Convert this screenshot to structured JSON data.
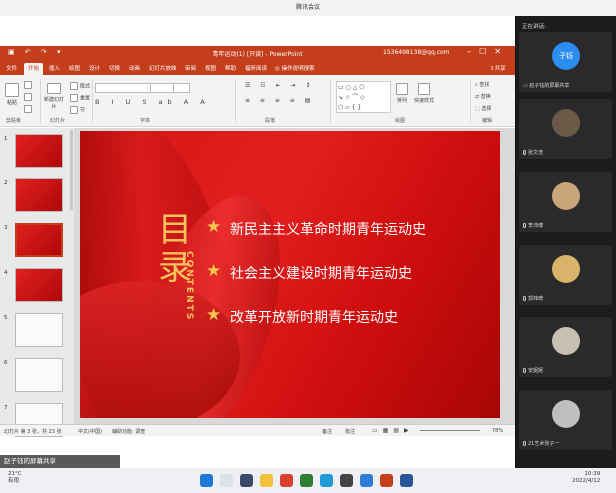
{
  "meeting": {
    "title": "腾讯会议",
    "shared_label": "赵子钰的屏幕共享"
  },
  "powerpoint": {
    "window_title": "青年运动(1) [只读] - PowerPoint",
    "account": "1536498138@qq.com",
    "tabs": [
      "文件",
      "开始",
      "插入",
      "绘图",
      "设计",
      "切换",
      "动画",
      "幻灯片放映",
      "审阅",
      "视图",
      "帮助",
      "福昕阅读",
      "操作说明搜索"
    ],
    "share_label": "共享",
    "ribbon": {
      "paste": "粘贴",
      "new_slide": "新建幻灯片",
      "reuse": "重用幻灯片",
      "groups": {
        "clipboard": "剪贴板",
        "slides": "幻灯片",
        "font": "字体",
        "paragraph": "段落",
        "drawing": "绘图",
        "editing": "编辑"
      },
      "find": "查找",
      "replace": "替换",
      "select": "选择",
      "arrange": "排列",
      "quick_styles": "快速样式",
      "cut": "剪切",
      "copy": "复制",
      "layout": "版式",
      "reset": "重置",
      "section": "节"
    },
    "slide": {
      "title": "目录",
      "title_top": "目",
      "title_bottom": "录",
      "subtitle": "CONTENTS",
      "items": [
        "新民主主义革命时期青年运动史",
        "社会主义建设时期青年运动史",
        "改革开放新时期青年运动史"
      ]
    },
    "thumbnails": [
      {
        "num": "1",
        "style": "red"
      },
      {
        "num": "2",
        "style": "red"
      },
      {
        "num": "3",
        "style": "red",
        "selected": true
      },
      {
        "num": "4",
        "style": "red"
      },
      {
        "num": "5",
        "style": "white"
      },
      {
        "num": "6",
        "style": "white"
      },
      {
        "num": "7",
        "style": "white"
      }
    ],
    "status": {
      "slide_info": "幻灯片 第 3 张，共 23 张",
      "language": "中文(中国)",
      "accessibility": "辅助功能: 调查",
      "notes": "备注",
      "comments": "批注",
      "zoom": "78%"
    }
  },
  "participants": {
    "speaking_label": "正在讲话:",
    "people": [
      {
        "name": "赵子钰的屏幕共享",
        "avatar_text": "子钰",
        "color": "#2d8cf0"
      },
      {
        "name": "张文浩",
        "color": "#6b5a48"
      },
      {
        "name": "李沛博",
        "color": "#c9a57a"
      },
      {
        "name": "郭玮琦",
        "color": "#d9b36a"
      },
      {
        "name": "安妮妮",
        "color": "#c8c0b0"
      },
      {
        "name": "21艺术张子一",
        "color": "#bfbfbf"
      }
    ]
  },
  "taskbar": {
    "weather_temp": "21°C",
    "weather_desc": "有雨",
    "time": "10:39",
    "date": "2022/4/12"
  }
}
